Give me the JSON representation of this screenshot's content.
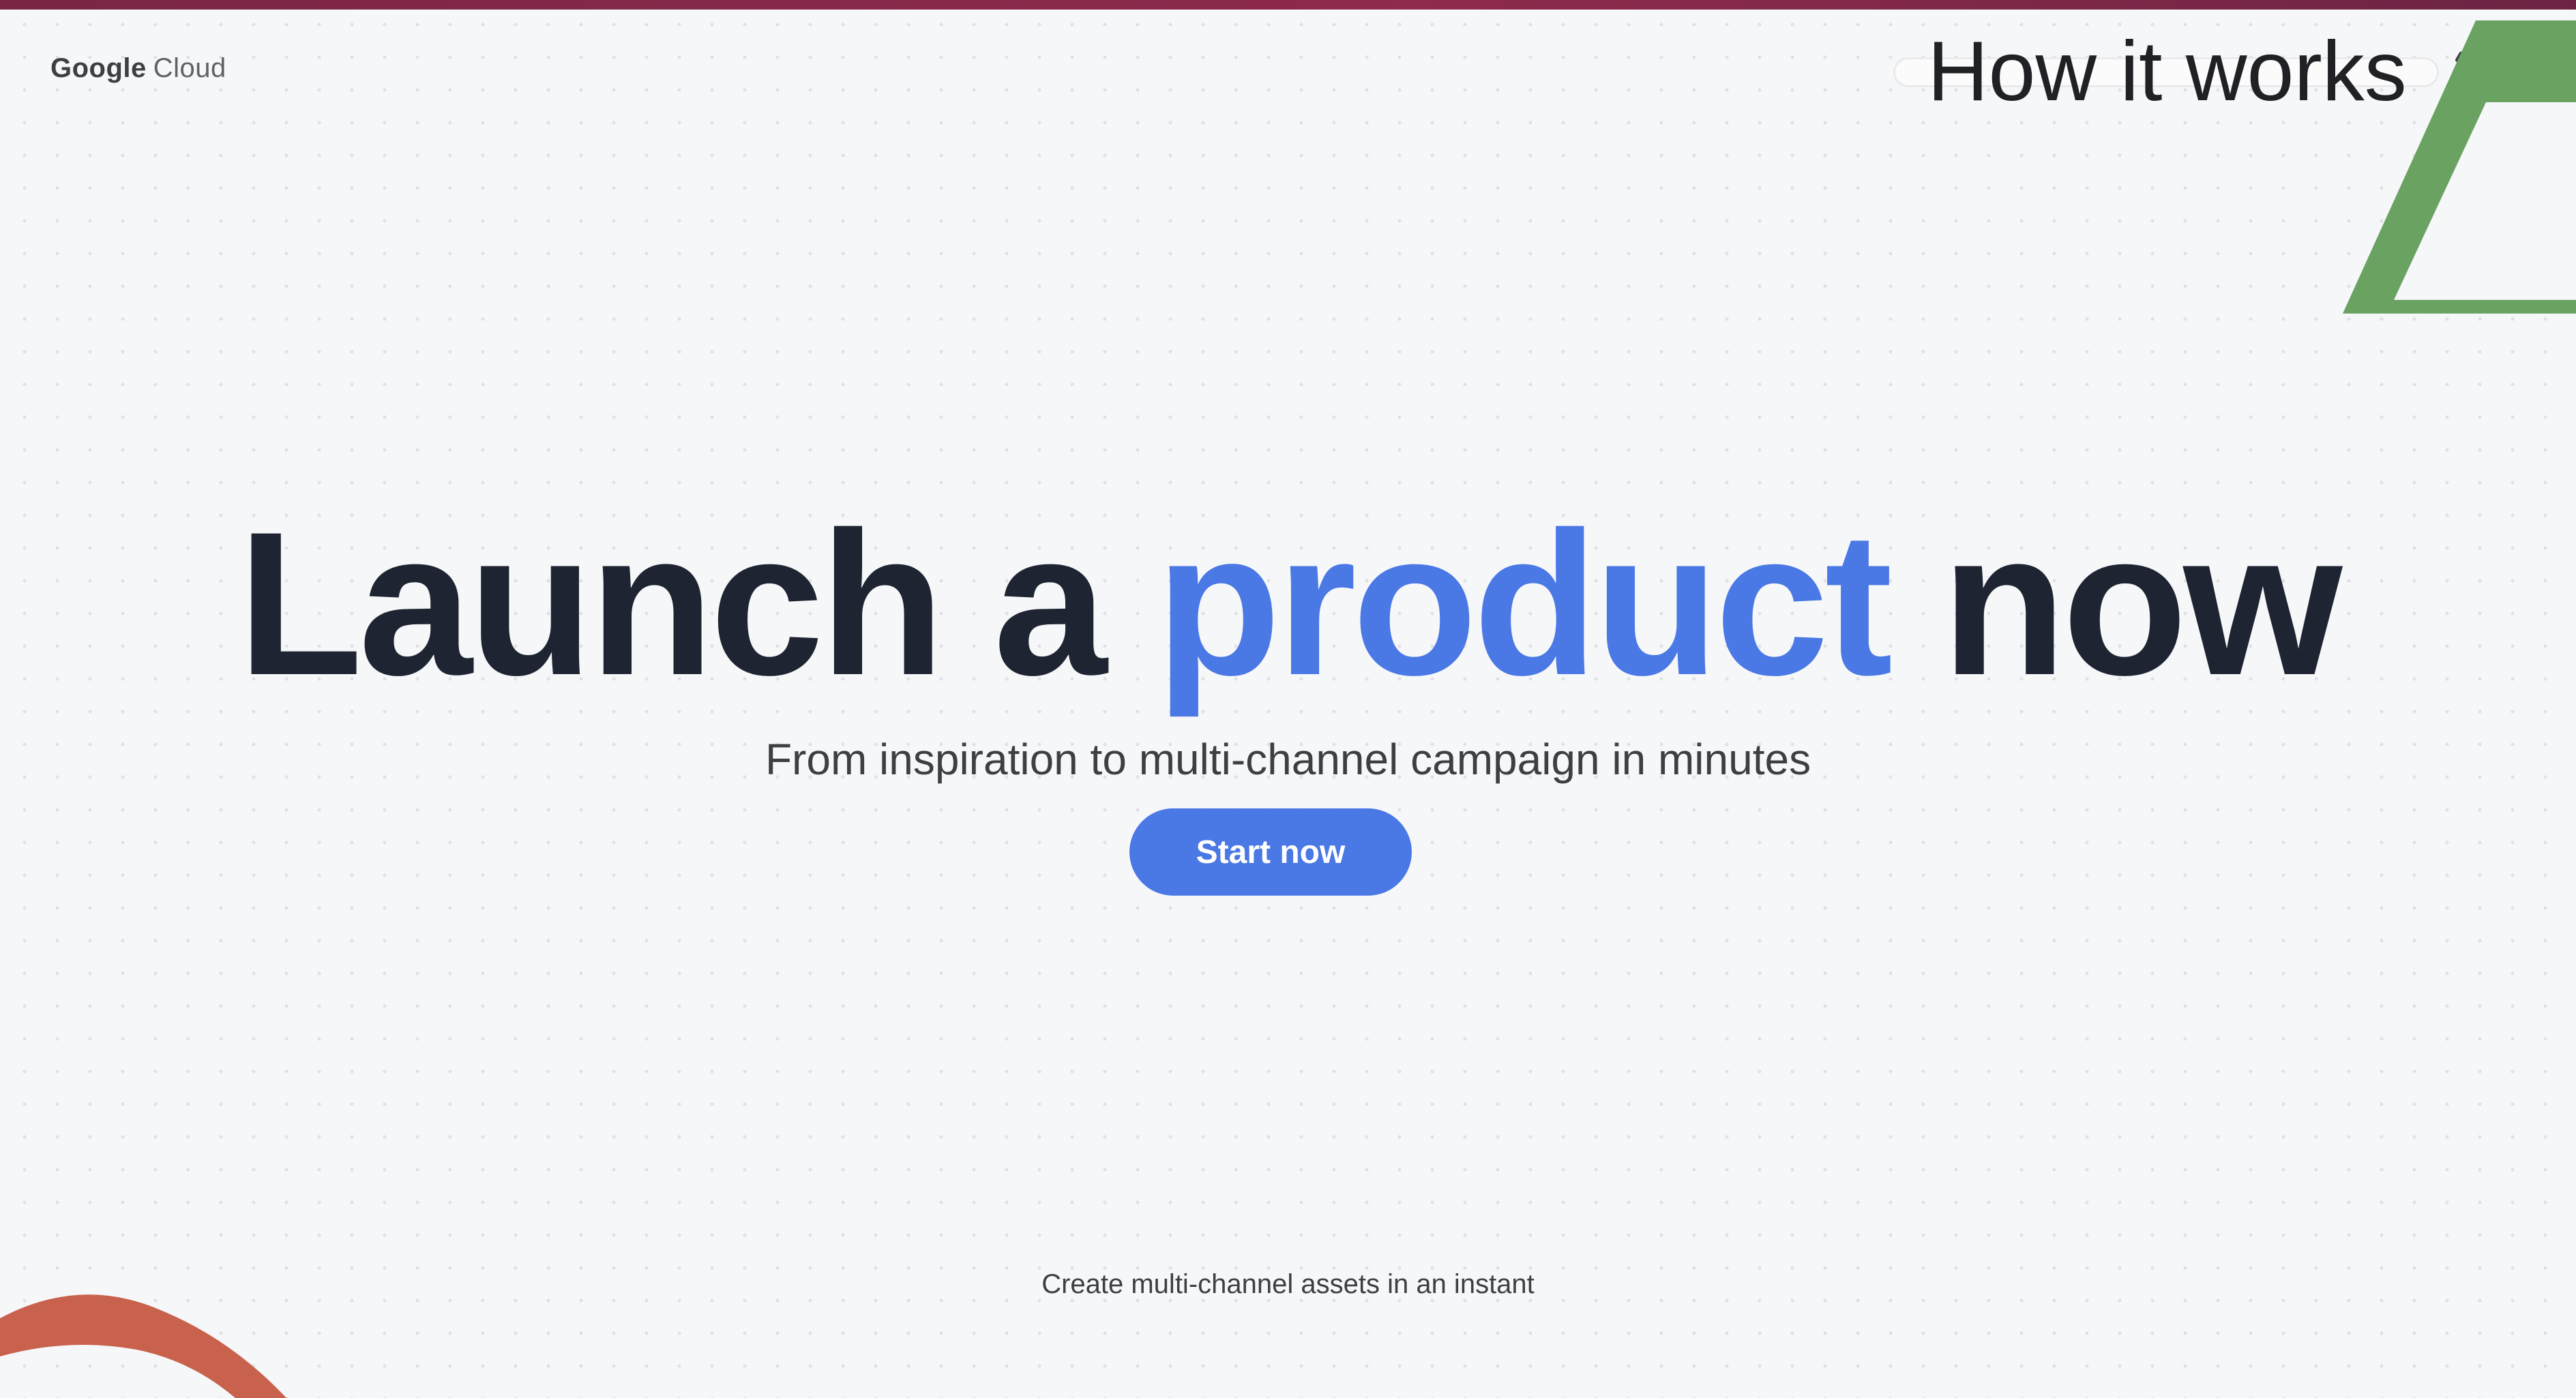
{
  "brand": {
    "google": "Google",
    "cloud": "Cloud"
  },
  "nav": {
    "how_it_works": "How it works",
    "settings_icon": "gear-icon"
  },
  "hero": {
    "headline_before": "Launch a ",
    "headline_accent": "product",
    "headline_after": " now",
    "subheadline": "From inspiration to multi-channel campaign in minutes",
    "cta_label": "Start now"
  },
  "footer": {
    "note": "Create multi-channel assets in an instant"
  },
  "colors": {
    "accent_blue": "#4a78e5",
    "headline_dark": "#1e2432",
    "triangle_green": "#6aa262",
    "circle_red": "#c9624c",
    "top_strip": "#8f2b4d",
    "background": "#f6f7f9"
  },
  "decorations": {
    "triangle": "green-triangle-outline",
    "circle": "red-circle-arc"
  }
}
